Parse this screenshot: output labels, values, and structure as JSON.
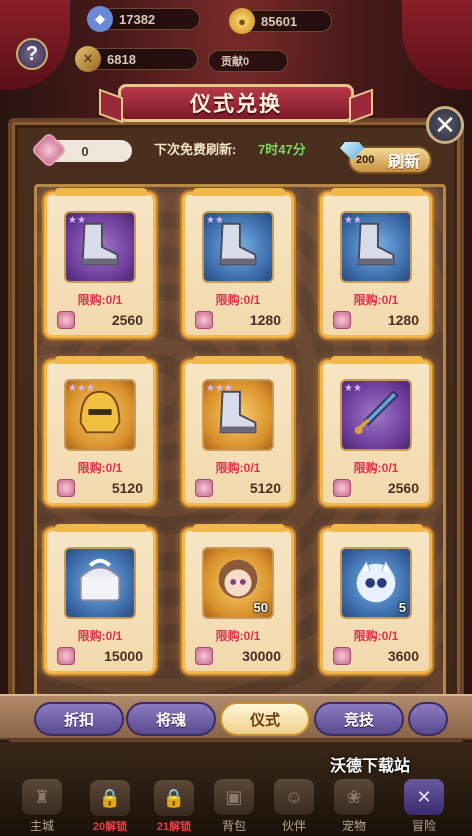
{
  "topbar": {
    "stat_a": "17382",
    "stat_b": "85601",
    "stat_c": "6818",
    "stat_d": "贡献0",
    "help_label": "?"
  },
  "panel": {
    "title": "仪式兑换",
    "close_label": "✕",
    "currency_value": "0",
    "refresh_label": "下次免费刷新:",
    "refresh_timer": "7时47分",
    "refresh_cost": "200",
    "refresh_button": "刷新"
  },
  "items": [
    {
      "limit": "限购:0/1",
      "price": "2560",
      "frame": "purple",
      "stars": "★★",
      "icon": "boots-icon",
      "num": ""
    },
    {
      "limit": "限购:0/1",
      "price": "1280",
      "frame": "blue",
      "stars": "★★",
      "icon": "boots-icon",
      "num": ""
    },
    {
      "limit": "限购:0/1",
      "price": "1280",
      "frame": "blue",
      "stars": "★★",
      "icon": "boots-icon",
      "num": ""
    },
    {
      "limit": "限购:0/1",
      "price": "5120",
      "frame": "gold",
      "stars": "★★★",
      "icon": "helmet-icon",
      "num": ""
    },
    {
      "limit": "限购:0/1",
      "price": "5120",
      "frame": "gold",
      "stars": "★★★",
      "icon": "boots-icon",
      "num": ""
    },
    {
      "limit": "限购:0/1",
      "price": "2560",
      "frame": "purple",
      "stars": "★★",
      "icon": "sword-icon",
      "num": ""
    },
    {
      "limit": "限购:0/1",
      "price": "15000",
      "frame": "blue",
      "stars": "",
      "icon": "chest-icon",
      "num": ""
    },
    {
      "limit": "限购:0/1",
      "price": "30000",
      "frame": "gold",
      "stars": "",
      "icon": "hero-portrait-icon",
      "num": "50"
    },
    {
      "limit": "限购:0/1",
      "price": "3600",
      "frame": "blue",
      "stars": "",
      "icon": "pet-portrait-icon",
      "num": "5"
    }
  ],
  "tabs": [
    {
      "label": "折扣"
    },
    {
      "label": "将魂"
    },
    {
      "label": "仪式"
    },
    {
      "label": "竞技"
    }
  ],
  "watermark": "沃德下载站",
  "nav": [
    {
      "label": "主城",
      "red": ""
    },
    {
      "label": "",
      "red": "20解锁"
    },
    {
      "label": "",
      "red": "21解锁"
    },
    {
      "label": "背包",
      "red": ""
    },
    {
      "label": "伙伴",
      "red": ""
    },
    {
      "label": "宠物",
      "red": ""
    },
    {
      "label": "冒险",
      "red": ""
    }
  ]
}
